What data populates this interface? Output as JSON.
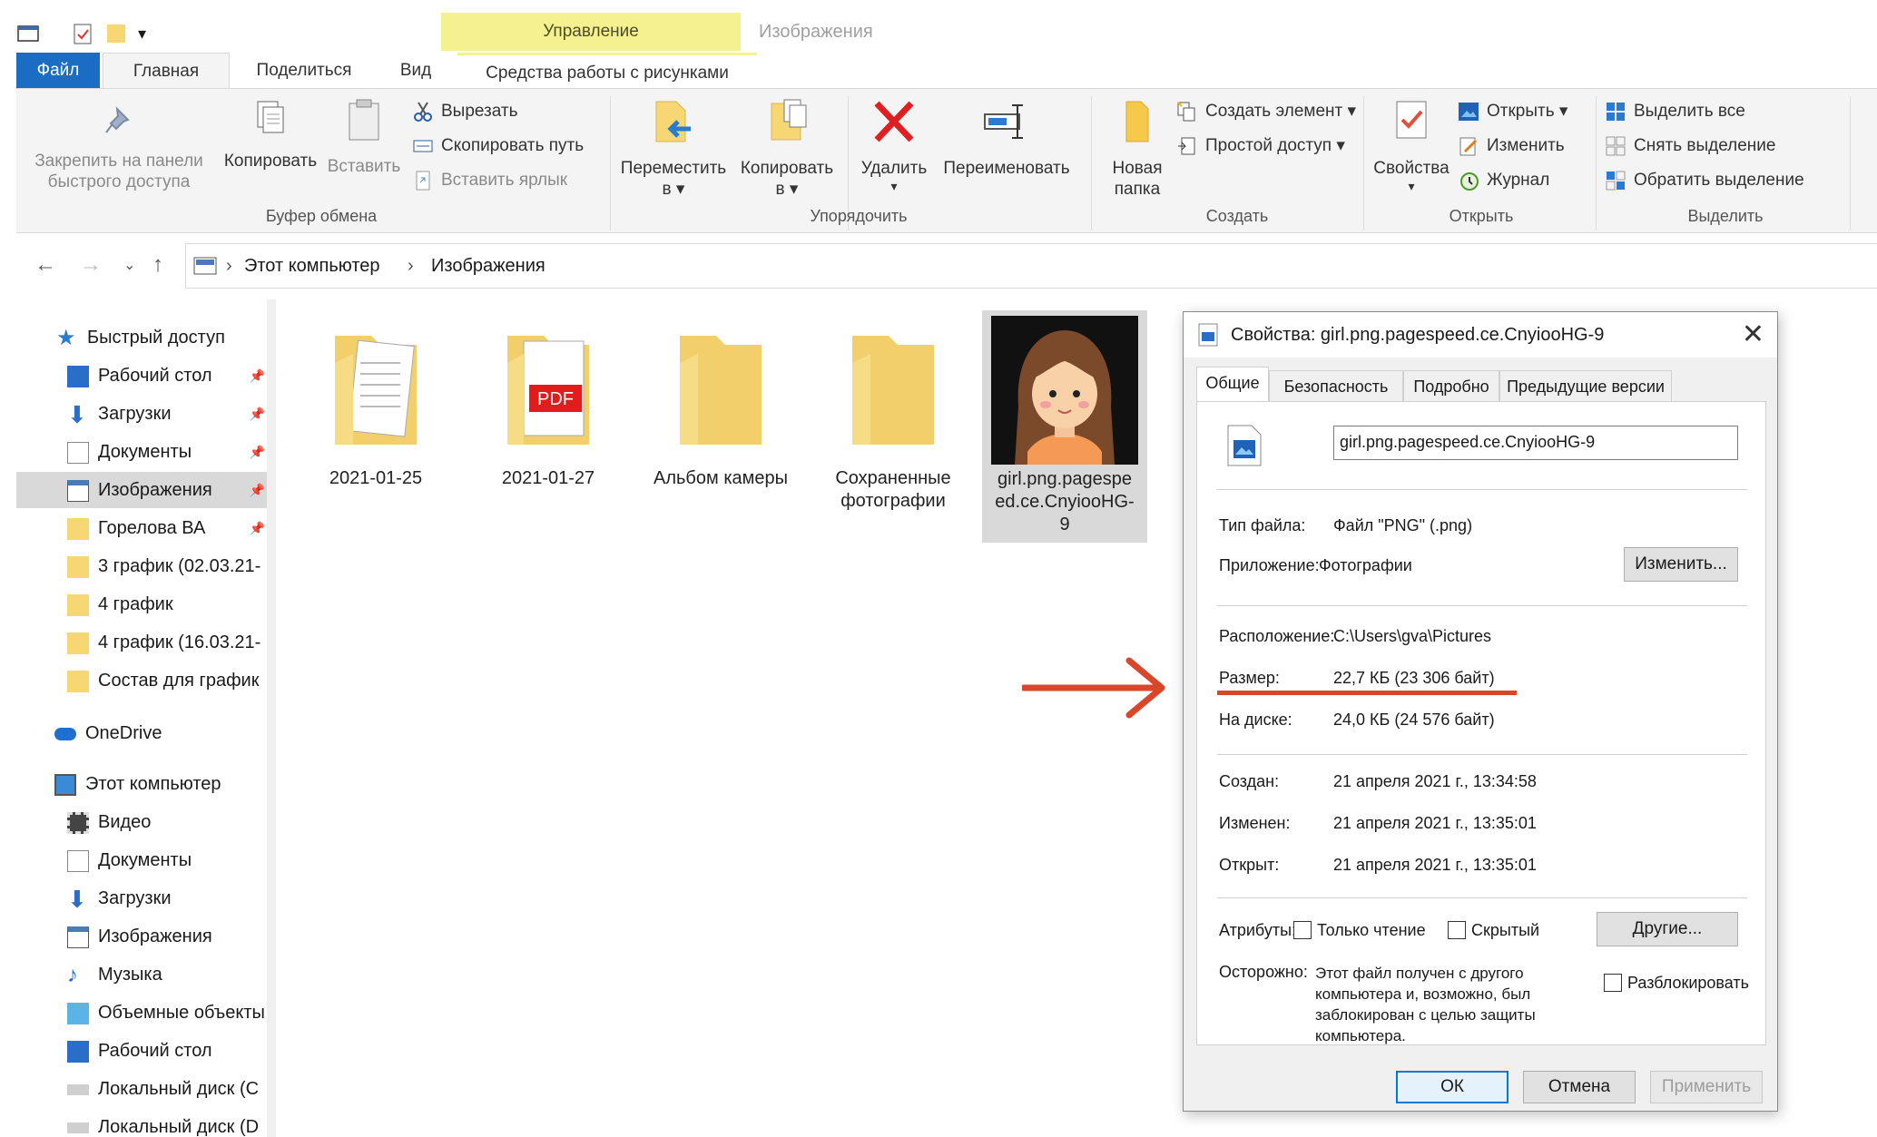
{
  "ribbon": {
    "context_group": "Управление",
    "context_title": "Изображения",
    "tabs": [
      "Файл",
      "Главная",
      "Поделиться",
      "Вид",
      "Средства работы с рисунками"
    ],
    "clipboard": {
      "pin": "Закрепить на панели быстрого доступа",
      "pin_l1": "Закрепить на панели",
      "pin_l2": "быстрого доступа",
      "copy": "Копировать",
      "paste": "Вставить",
      "cut": "Вырезать",
      "copy_path": "Скопировать путь",
      "paste_shortcut": "Вставить ярлык",
      "label": "Буфер обмена"
    },
    "organize": {
      "move_to_l1": "Переместить",
      "move_to_l2": "в",
      "copy_to_l1": "Копировать",
      "copy_to_l2": "в",
      "delete": "Удалить",
      "rename": "Переименовать",
      "label": "Упорядочить"
    },
    "create": {
      "new_folder_l1": "Новая",
      "new_folder_l2": "папка",
      "new_item": "Создать элемент",
      "easy_access": "Простой доступ",
      "label": "Создать"
    },
    "open": {
      "properties": "Свойства",
      "open": "Открыть",
      "edit": "Изменить",
      "history": "Журнал",
      "label": "Открыть"
    },
    "select": {
      "select_all": "Выделить все",
      "select_none": "Снять выделение",
      "invert": "Обратить выделение",
      "label": "Выделить"
    }
  },
  "breadcrumb": [
    "Этот компьютер",
    "Изображения"
  ],
  "sidebar": {
    "quick_access": "Быстрый доступ",
    "quick_items": [
      "Рабочий стол",
      "Загрузки",
      "Документы",
      "Изображения",
      "Горелова ВА",
      "3 график (02.03.21-",
      "4 график",
      "4 график (16.03.21-",
      "Состав для график"
    ],
    "onedrive": "OneDrive",
    "this_pc": "Этот компьютер",
    "pc_items": [
      "Видео",
      "Документы",
      "Загрузки",
      "Изображения",
      "Музыка",
      "Объемные объекты",
      "Рабочий стол",
      "Локальный диск (C",
      "Локальный диск (D"
    ]
  },
  "files": [
    {
      "name": "2021-01-25"
    },
    {
      "name": "2021-01-27",
      "badge": "PDF"
    },
    {
      "name": "Альбом камеры"
    },
    {
      "name_l1": "Сохраненные",
      "name_l2": "фотографии"
    },
    {
      "name_l1": "girl.png.pagespe",
      "name_l2": "ed.ce.CnyiooHG-",
      "name_l3": "9"
    }
  ],
  "dialog": {
    "title": "Свойства: girl.png.pagespeed.ce.CnyiooHG-9",
    "tabs": [
      "Общие",
      "Безопасность",
      "Подробно",
      "Предыдущие версии"
    ],
    "filename": "girl.png.pagespeed.ce.CnyiooHG-9",
    "file_type_label": "Тип файла:",
    "file_type": "Файл \"PNG\" (.png)",
    "app_label": "Приложение:",
    "app": "Фотографии",
    "change_btn": "Изменить...",
    "location_label": "Расположение:",
    "location": "C:\\Users\\gva\\Pictures",
    "size_label": "Размер:",
    "size": "22,7 КБ (23 306 байт)",
    "disk_label": "На диске:",
    "disk": "24,0 КБ (24 576 байт)",
    "created_label": "Создан:",
    "created": "21 апреля 2021 г., 13:34:58",
    "modified_label": "Изменен:",
    "modified": "21 апреля 2021 г., 13:35:01",
    "opened_label": "Открыт:",
    "opened": "21 апреля 2021 г., 13:35:01",
    "attrs_label": "Атрибуты:",
    "readonly": "Только чтение",
    "hidden": "Скрытый",
    "other_btn": "Другие...",
    "warning_label": "Осторожно:",
    "warning_l1": "Этот файл получен с другого",
    "warning_l2": "компьютера и, возможно, был",
    "warning_l3": "заблокирован с целью защиты",
    "warning_l4": "компьютера.",
    "unblock": "Разблокировать",
    "ok": "ОК",
    "cancel": "Отмена",
    "apply": "Применить"
  },
  "colors": {
    "annotation": "#d9472b",
    "file_tab": "#1a6dc2",
    "context_band": "#f5f18e"
  }
}
